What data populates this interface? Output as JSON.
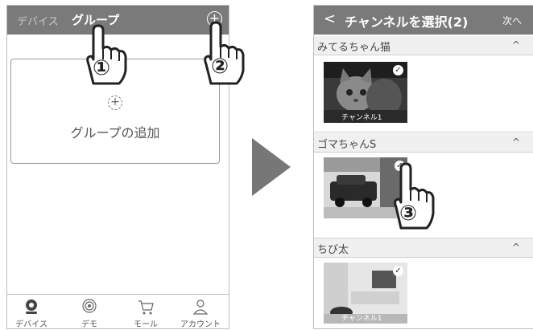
{
  "left": {
    "tabs": {
      "devices": "デバイス",
      "group": "グループ"
    },
    "add_group": {
      "label": "グループの追加"
    },
    "nav": [
      {
        "label": "デバイス",
        "icon": "camera-icon"
      },
      {
        "label": "デモ",
        "icon": "demo-icon"
      },
      {
        "label": "モール",
        "icon": "cart-icon"
      },
      {
        "label": "アカウント",
        "icon": "account-icon"
      }
    ]
  },
  "steps": {
    "step1": "①",
    "step2": "②",
    "step3": "③"
  },
  "right": {
    "back": "<",
    "title": "チャンネルを選択(2)",
    "next": "次へ",
    "groups": [
      {
        "name": "みてるちゃん猫",
        "channel": "チャンネル1"
      },
      {
        "name": "ゴマちゃんS",
        "channel": ""
      },
      {
        "name": "ちび太",
        "channel": "チャンネル1"
      }
    ],
    "chevron": "^",
    "check": "✓"
  },
  "colors": {
    "header": "#7a7a7a",
    "border": "#bdbdbd",
    "group_bg": "#f0f0f0"
  }
}
